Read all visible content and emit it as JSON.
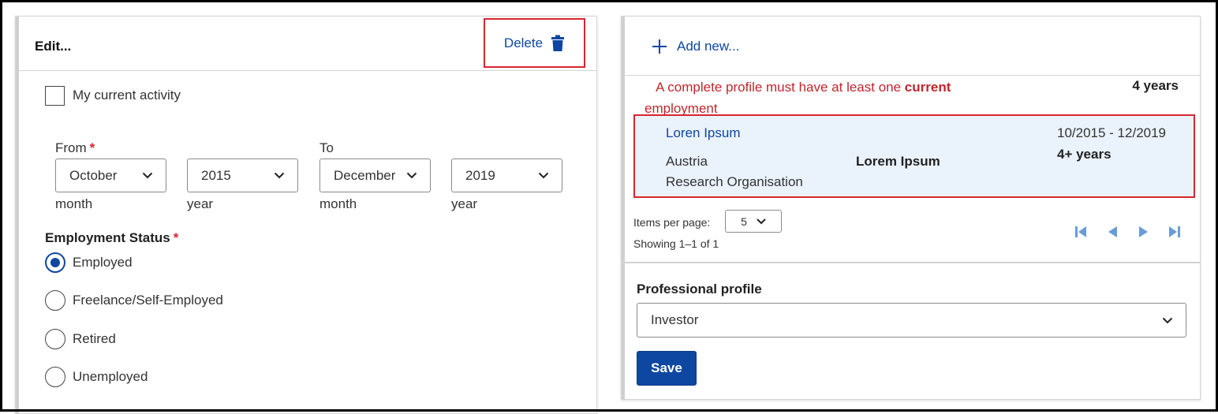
{
  "edit_panel": {
    "title": "Edit...",
    "delete_label": "Delete",
    "current_activity_label": "My current activity",
    "current_activity_checked": false,
    "from_label": "From",
    "to_label": "To",
    "required_mark": "*",
    "from_month": "October",
    "from_year": "2015",
    "to_month": "December",
    "to_year": "2019",
    "month_caption": "month",
    "year_caption": "year",
    "employment_status_label": "Employment Status",
    "status_options": [
      "Employed",
      "Freelance/Self-Employed",
      "Retired",
      "Unemployed"
    ],
    "status_selected": "Employed"
  },
  "list_panel": {
    "add_new_label": "Add new...",
    "warning_prefix": "A complete profile must have at least one ",
    "warning_bold": "current",
    "warning_suffix": "employment",
    "total_years": "4 years",
    "entry": {
      "name": "Loren Ipsum",
      "country": "Austria",
      "type": "Research Organisation",
      "organisation": "Lorem Ipsum",
      "period": "10/2015 - 12/2019",
      "duration": "4+ years"
    },
    "items_per_page_label": "Items per page:",
    "items_per_page": "5",
    "showing": "Showing 1–1 of 1"
  },
  "profile_panel": {
    "label": "Professional profile",
    "value": "Investor",
    "save_label": "Save"
  },
  "colors": {
    "accent": "#0e47a1",
    "warning": "#c0262d",
    "highlight_bg": "#eaf2fb"
  }
}
